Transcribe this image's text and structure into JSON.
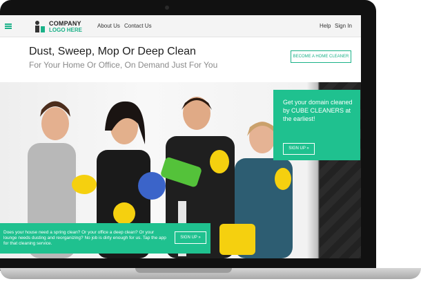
{
  "nav": {
    "logo_line1": "COMPANY",
    "logo_line2": "LOGO HERE",
    "links": [
      "About Us",
      "Contact Us"
    ],
    "right_links": [
      "Help",
      "Sign In"
    ]
  },
  "hero": {
    "title": "Dust, Sweep, Mop Or Deep Clean",
    "subtitle": "For Your Home Or Office, On Demand Just For You",
    "cta_label": "BECOME A HOME CLEANER"
  },
  "card": {
    "text": "Get your domain cleaned by CUBE CLEANERS at the earliest!",
    "button_label": "SIGN UP »"
  },
  "strip": {
    "text": "Does your house need a spring clean? Or your office a deep clean? Or your lounge needs dusting and reorganizing? No job is dirty enough for us. Tap the app for that cleaning service.",
    "button_label": "SIGN UP »"
  },
  "colors": {
    "accent": "#1fc18f",
    "dark": "#1d1d1d"
  }
}
